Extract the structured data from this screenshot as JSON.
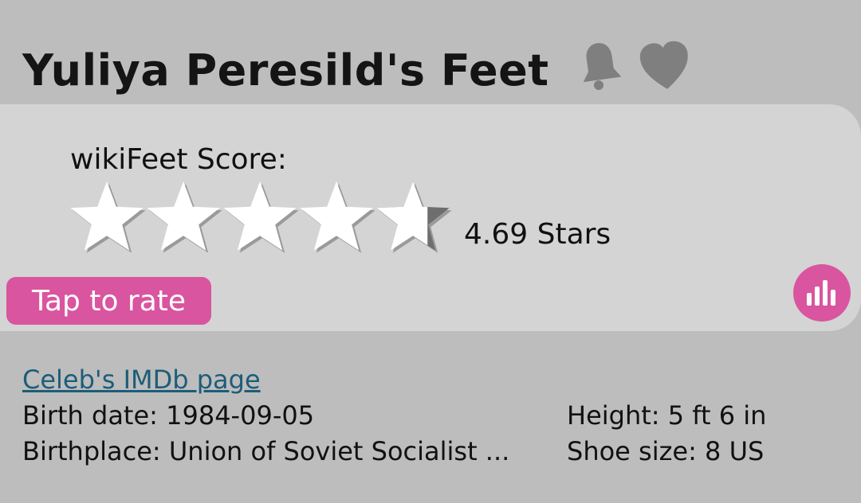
{
  "header": {
    "title": "Yuliya Peresild's Feet",
    "icons": [
      "bell-icon",
      "heart-icon"
    ]
  },
  "rating": {
    "label": "wikiFeet Score:",
    "value": 4.69,
    "max": 5,
    "value_text": "4.69 Stars",
    "rate_button": "Tap to rate",
    "stats_icon": "bar-chart-icon"
  },
  "info": {
    "imdb_link": "Celeb's IMDb page",
    "birth_label": "Birth date:",
    "birth_value": "1984-09-05",
    "birthplace_label": "Birthplace:",
    "birthplace_value": "Union of Soviet Socialist ...",
    "height_label": "Height:",
    "height_value": "5 ft 6 in",
    "shoe_label": "Shoe size:",
    "shoe_value": "8 US"
  },
  "colors": {
    "accent": "#d9559f",
    "link": "#1d5d79",
    "background": "#bdbdbd",
    "card": "#d4d4d4"
  }
}
